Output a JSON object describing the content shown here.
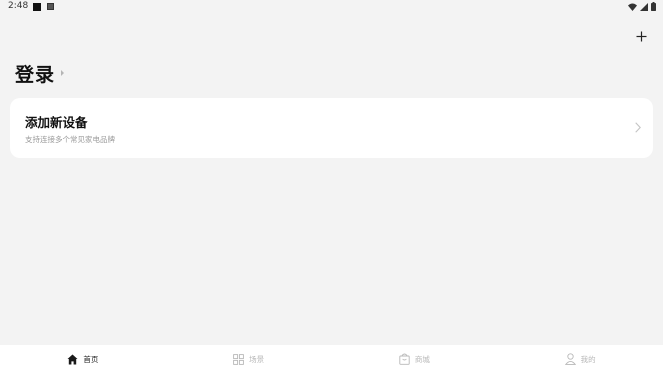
{
  "status_bar": {
    "time": "2:48"
  },
  "header": {
    "add_icon": "plus-icon"
  },
  "login": {
    "title": "登录"
  },
  "device_card": {
    "title": "添加新设备",
    "subtitle": "支持连接多个常见家电品牌",
    "chevron_icon": "chevron-right-icon"
  },
  "bottom_nav": {
    "items": [
      {
        "label": "首页",
        "icon": "home-icon",
        "active": true
      },
      {
        "label": "场景",
        "icon": "grid-icon",
        "active": false
      },
      {
        "label": "商城",
        "icon": "shopping-bag-icon",
        "active": false
      },
      {
        "label": "我的",
        "icon": "person-icon",
        "active": false
      }
    ]
  },
  "colors": {
    "background": "#f3f3f3",
    "card": "#ffffff",
    "active_nav": "#222222",
    "inactive_nav": "#b8b8b8"
  }
}
